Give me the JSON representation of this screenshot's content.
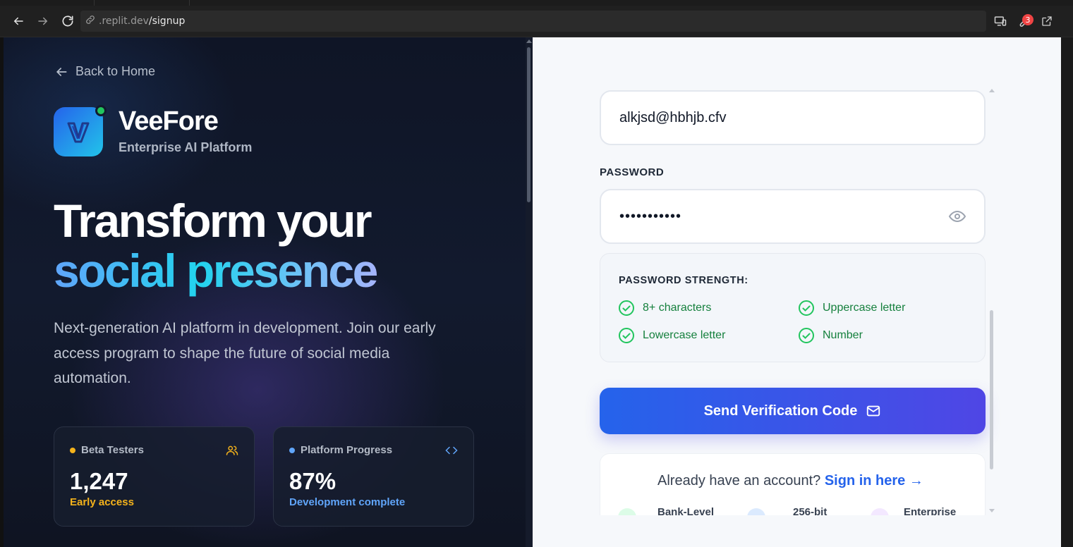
{
  "browser": {
    "url_domain": ".replit.dev",
    "url_path": "/signup",
    "notification_count": "3"
  },
  "hero": {
    "back_label": "Back to Home",
    "brand_name": "VeeFore",
    "brand_tagline": "Enterprise AI Platform",
    "headline_line1": "Transform your",
    "headline_line2": "social presence",
    "description": "Next-generation AI platform in development. Join our early access program to shape the future of social media automation."
  },
  "stats": [
    {
      "label": "Beta Testers",
      "value": "1,247",
      "sub": "Early access",
      "dot_color": "#f5b31b",
      "sub_color": "#f5b31b",
      "icon": "users-icon"
    },
    {
      "label": "Platform Progress",
      "value": "87%",
      "sub": "Development complete",
      "dot_color": "#60a5fa",
      "sub_color": "#60a5fa",
      "icon": "code-icon"
    }
  ],
  "form": {
    "email_value": "alkjsd@hbhjb.cfv",
    "password_label": "PASSWORD",
    "password_value": "•••••••••••",
    "strength_title": "PASSWORD STRENGTH:",
    "requirements": [
      {
        "label": "8+ characters",
        "met": true
      },
      {
        "label": "Uppercase letter",
        "met": true
      },
      {
        "label": "Lowercase letter",
        "met": true
      },
      {
        "label": "Number",
        "met": true
      }
    ],
    "submit_label": "Send Verification Code",
    "already_text": "Already have an account?",
    "signin_label": "Sign in here →",
    "features": [
      "Bank-Level",
      "256-bit",
      "Enterprise"
    ]
  },
  "colors": {
    "accent_blue": "#2563eb",
    "accent_indigo": "#4f46e5",
    "success_green": "#15803d"
  }
}
